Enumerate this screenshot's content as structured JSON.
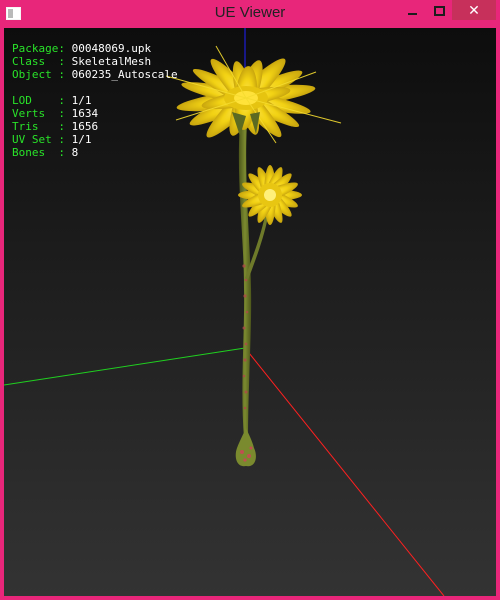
{
  "window": {
    "title": "UE Viewer",
    "close_glyph": "✕"
  },
  "info_group1": [
    {
      "label": "Package:",
      "value": "00048069.upk"
    },
    {
      "label": "Class  :",
      "value": "SkeletalMesh"
    },
    {
      "label": "Object :",
      "value": "060235_Autoscale"
    }
  ],
  "info_group2": [
    {
      "label": "LOD    :",
      "value": "1/1"
    },
    {
      "label": "Verts  :",
      "value": "1634"
    },
    {
      "label": "Tris   :",
      "value": "1656"
    },
    {
      "label": "UV Set :",
      "value": "1/1"
    },
    {
      "label": "Bones  :",
      "value": "8"
    }
  ],
  "colors": {
    "title_bar": "#e8267a",
    "close_button": "#c7305b",
    "info_label": "#29e329",
    "info_value": "#ffffff",
    "axis_x": "#ff2020",
    "axis_y": "#20d020",
    "axis_z": "#2020ff",
    "petal": "#f2d214",
    "stem": "#6e7a2a"
  }
}
